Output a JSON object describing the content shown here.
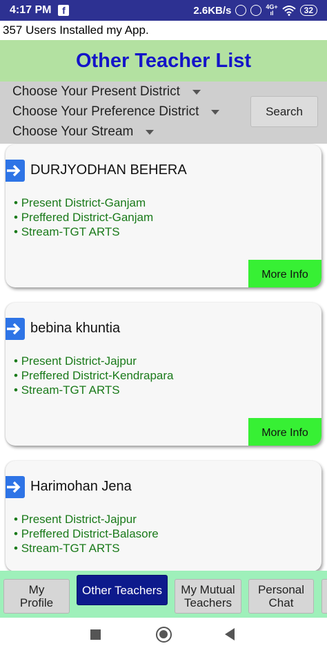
{
  "status_bar": {
    "time": "4:17 PM",
    "fb": "f",
    "net_speed": "2.6KB/s",
    "sig_top": "4G+",
    "sig_bot": "ıl",
    "battery": "32"
  },
  "installed_text": "357 Users Installed my App.",
  "header": {
    "title": "Other Teacher List"
  },
  "filters": {
    "present_district": "Choose Your Present District",
    "preference_district": "Choose Your Preference District",
    "stream": "Choose Your Stream",
    "search_label": "Search"
  },
  "teachers": [
    {
      "name": "DURJYODHAN BEHERA",
      "present": "Present District-Ganjam",
      "preferred": "Preffered District-Ganjam",
      "stream": "Stream-TGT ARTS",
      "more": "More Info"
    },
    {
      "name": "bebina khuntia",
      "present": "Present District-Jajpur",
      "preferred": "Preffered District-Kendrapara",
      "stream": "Stream-TGT ARTS",
      "more": "More Info"
    },
    {
      "name": "Harimohan Jena",
      "present": "Present District-Jajpur",
      "preferred": "Preffered District-Balasore",
      "stream": "Stream-TGT ARTS",
      "more": "More Info"
    }
  ],
  "bottom_nav": {
    "my_profile_1": "My",
    "my_profile_2": "Profile",
    "other_teachers": "Other Teachers",
    "mutual_1": "My Mutual",
    "mutual_2": "Teachers",
    "chat_1": "Personal",
    "chat_2": "Chat"
  },
  "colors": {
    "status_bar": "#2d3192",
    "header_bg": "#b3e1a1",
    "title": "#1414c8",
    "detail_text": "#1a7a1a",
    "more_button": "#37f034",
    "active_nav": "#0d1a8c",
    "nav_bg": "#9ef0ba"
  },
  "icons": {
    "card_icon": "arrow-right-box-icon",
    "system_nav": [
      "recents-square-icon",
      "home-circle-icon",
      "back-triangle-icon"
    ]
  }
}
